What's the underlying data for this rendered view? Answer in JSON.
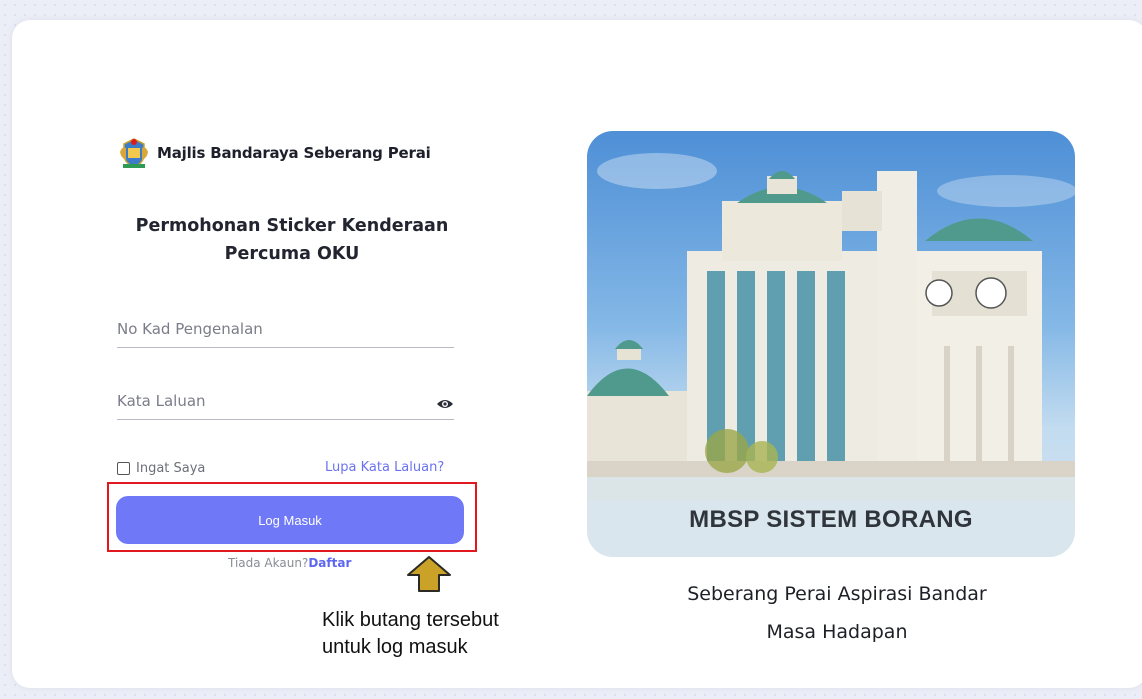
{
  "brand": {
    "name": "Majlis Bandaraya Seberang Perai",
    "icon": "crest-icon"
  },
  "form": {
    "title": "Permohonan Sticker Kenderaan Percuma OKU",
    "ic_placeholder": "No Kad Pengenalan",
    "password_placeholder": "Kata Laluan",
    "remember_label": "Ingat Saya",
    "forgot_label": "Lupa Kata Laluan?",
    "login_label": "Log Masuk",
    "no_account_text": "Tiada Akaun?",
    "register_label": "Daftar"
  },
  "annotation": {
    "line1": "Klik butang tersebut",
    "line2": "untuk log masuk",
    "highlight_color": "#e1191f",
    "arrow_color": "#c9a227"
  },
  "hero": {
    "caption": "MBSP SISTEM BORANG",
    "slogan_line1": "Seberang Perai Aspirasi Bandar",
    "slogan_line2": "Masa Hadapan"
  },
  "colors": {
    "accent": "#6f79f7",
    "link": "#6a72f0"
  }
}
